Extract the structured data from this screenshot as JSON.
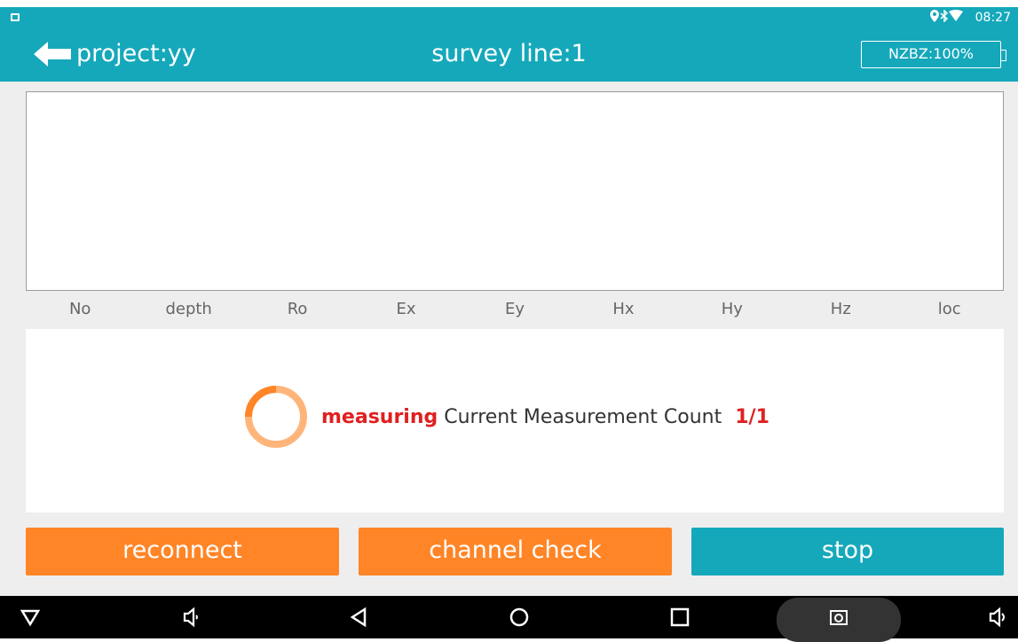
{
  "colors": {
    "accent": "#15a8bb",
    "button_orange": "#ff8527",
    "highlight_red": "#e02020"
  },
  "status_bar": {
    "time": "08:27",
    "icons": [
      "location-icon",
      "bluetooth-icon",
      "wifi-icon"
    ]
  },
  "app_bar": {
    "project": "project:yy",
    "survey_line": "survey line:1",
    "battery": "NZBZ:100%"
  },
  "table": {
    "columns": [
      "No",
      "depth",
      "Ro",
      "Ex",
      "Ey",
      "Hx",
      "Hy",
      "Hz",
      "loc"
    ]
  },
  "measurement": {
    "state": "measuring",
    "label": "Current Measurement Count",
    "count": "1/1"
  },
  "buttons": {
    "reconnect": "reconnect",
    "channel_check": "channel check",
    "stop": "stop"
  },
  "nav_bar": {
    "icons": [
      "hide-nav-icon",
      "volume-down-icon",
      "back-icon",
      "home-icon",
      "recents-icon",
      "screenshot-icon",
      "volume-up-icon"
    ]
  }
}
